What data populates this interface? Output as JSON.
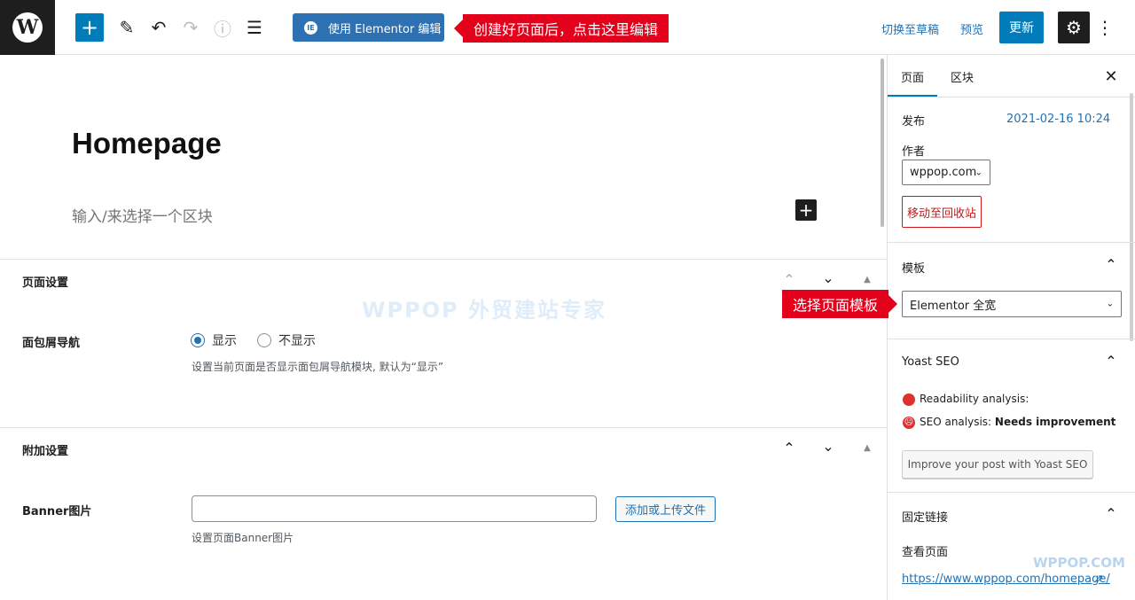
{
  "topbar": {
    "wp_logo": "W",
    "add_icon": "+",
    "tools_icon": "✎",
    "undo_icon": "↶",
    "redo_icon": "↷",
    "info_icon": "ⓘ",
    "outline_icon": "☰",
    "elementor_icon": "IE",
    "elementor_label": "使用 Elementor 编辑",
    "callout_text": "创建好页面后，点击这里编辑",
    "draft_link": "切换至草稿",
    "preview_link": "预览",
    "update_label": "更新",
    "gear_icon": "⚙",
    "more_icon": "⋮"
  },
  "editor": {
    "title": "Homepage",
    "block_placeholder": "输入/来选择一个区块",
    "inline_add": "+",
    "watermark": "WPPOP 外贸建站专家"
  },
  "page_settings": {
    "title": "页面设置",
    "up": "⌃",
    "down": "⌄",
    "toggle": "▲",
    "field_label": "面包屑导航",
    "options": [
      "显示",
      "不显示"
    ],
    "selected": "显示",
    "description": "设置当前页面是否显示面包屑导航模块, 默认为“显示”"
  },
  "extra_settings": {
    "title": "附加设置",
    "up": "⌃",
    "down": "⌄",
    "toggle": "▲",
    "field_label": "Banner图片",
    "input_value": "",
    "upload_label": "添加或上传文件",
    "description": "设置页面Banner图片"
  },
  "sidebar": {
    "tabs": [
      "页面",
      "区块"
    ],
    "active_tab": "页面",
    "close_icon": "✕",
    "publish_label": "发布",
    "publish_value": "2021-02-16 10:24",
    "author_label": "作者",
    "author_value": "wppop.com",
    "trash_label": "移动至回收站",
    "template_section": "模板",
    "template_value": "Elementor 全宽",
    "template_callout": "选择页面模板",
    "yoast_section": "Yoast SEO",
    "readability": "Readability analysis:",
    "seo_label": "SEO analysis:",
    "seo_value": "Needs improvement",
    "yoast_button": "Improve your post with Yoast SEO",
    "permalink_section": "固定链接",
    "view_page_label": "查看页面",
    "permalink_url": "https://www.wppop.com/homepage/",
    "ext_icon": "⇗",
    "chevron_up": "⌃",
    "select_chevron": "⌄"
  },
  "watermark_br": "WPPOP.COM",
  "colors": {
    "accent": "#007cba",
    "elementor": "#2d71b2",
    "callout": "#e2001a",
    "danger": "#cc1818",
    "yoast_red": "#dc3232"
  }
}
